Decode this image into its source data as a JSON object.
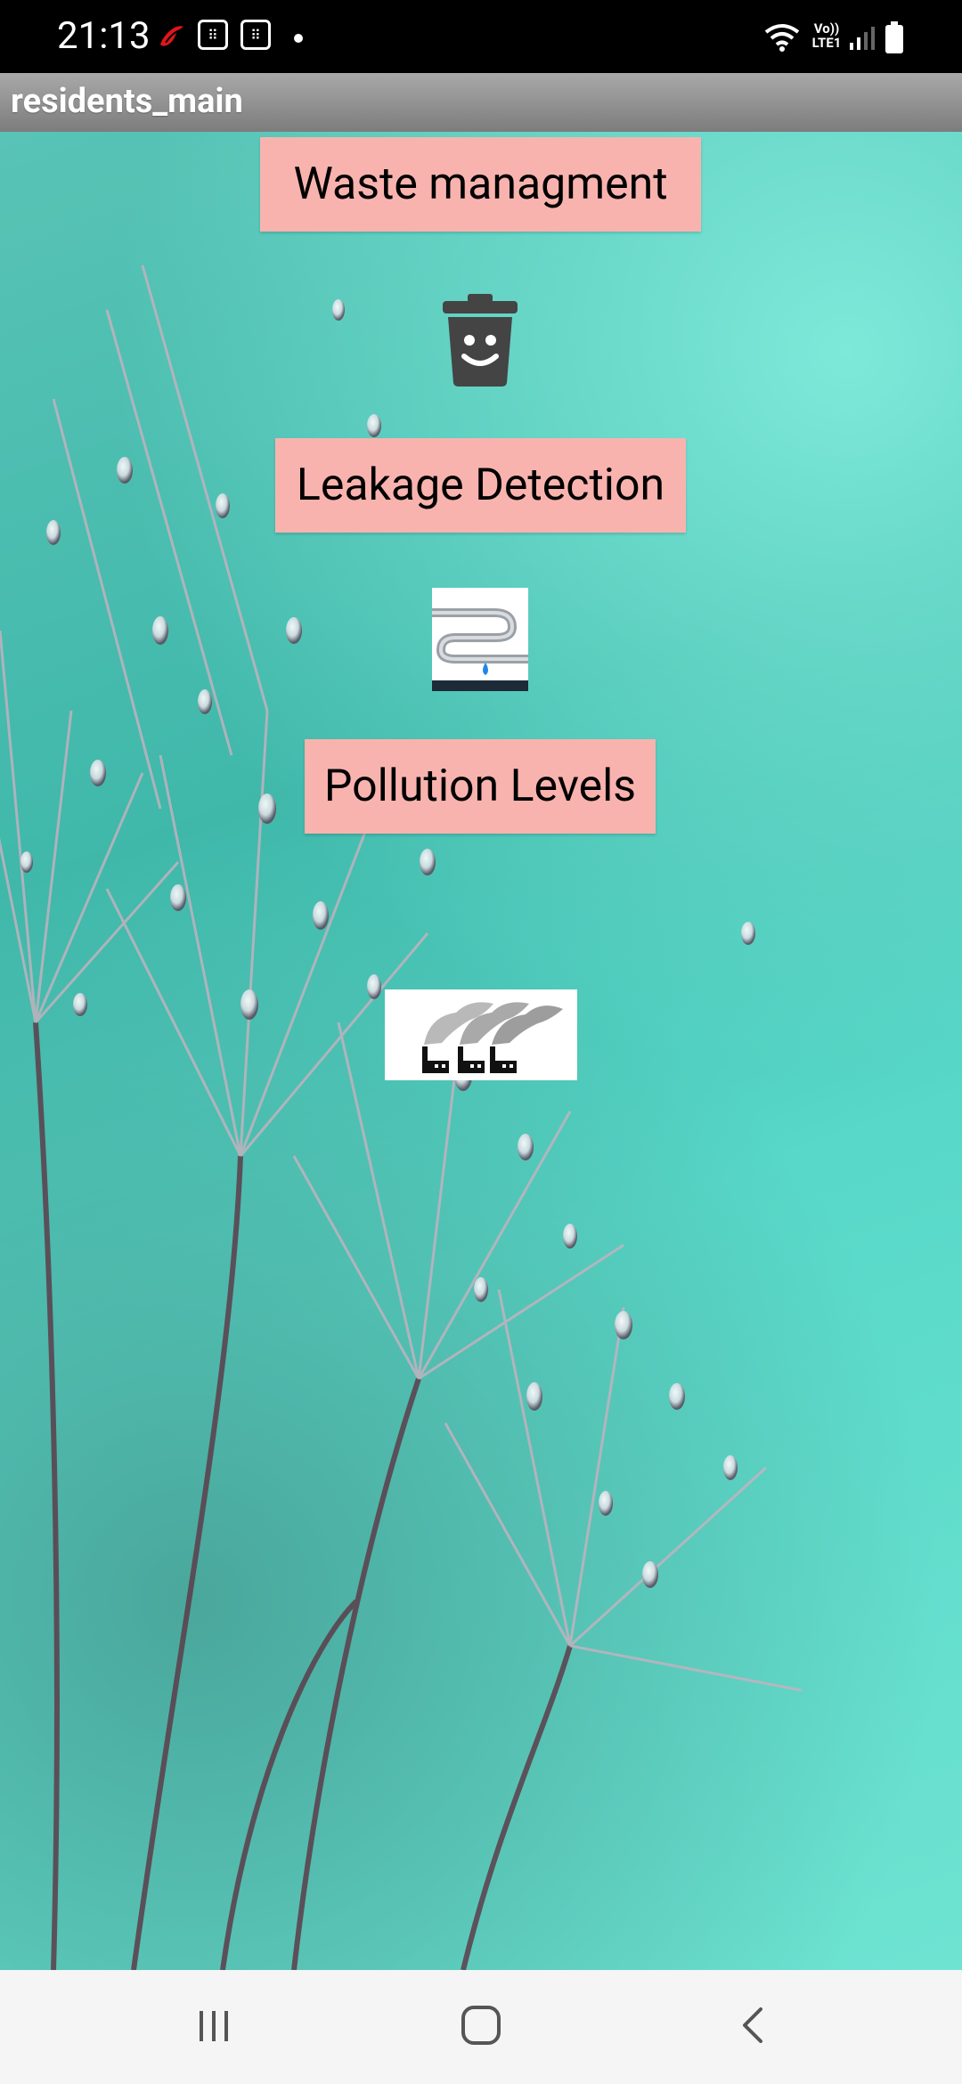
{
  "status_bar": {
    "time": "21:13",
    "network_label": "Vo)) LTE1"
  },
  "action_bar": {
    "title": "residents_main"
  },
  "buttons": {
    "waste": "Waste managment",
    "leakage": "Leakage Detection",
    "pollution": "Pollution Levels"
  },
  "icons": {
    "waste": "trash-bin-smiley-icon",
    "leakage": "water-pipe-leak-icon",
    "pollution": "factory-smoke-icon"
  },
  "colors": {
    "button_bg": "#f9b3ae",
    "action_bar": "#8e8e8e",
    "background": "#4fc4b5"
  }
}
